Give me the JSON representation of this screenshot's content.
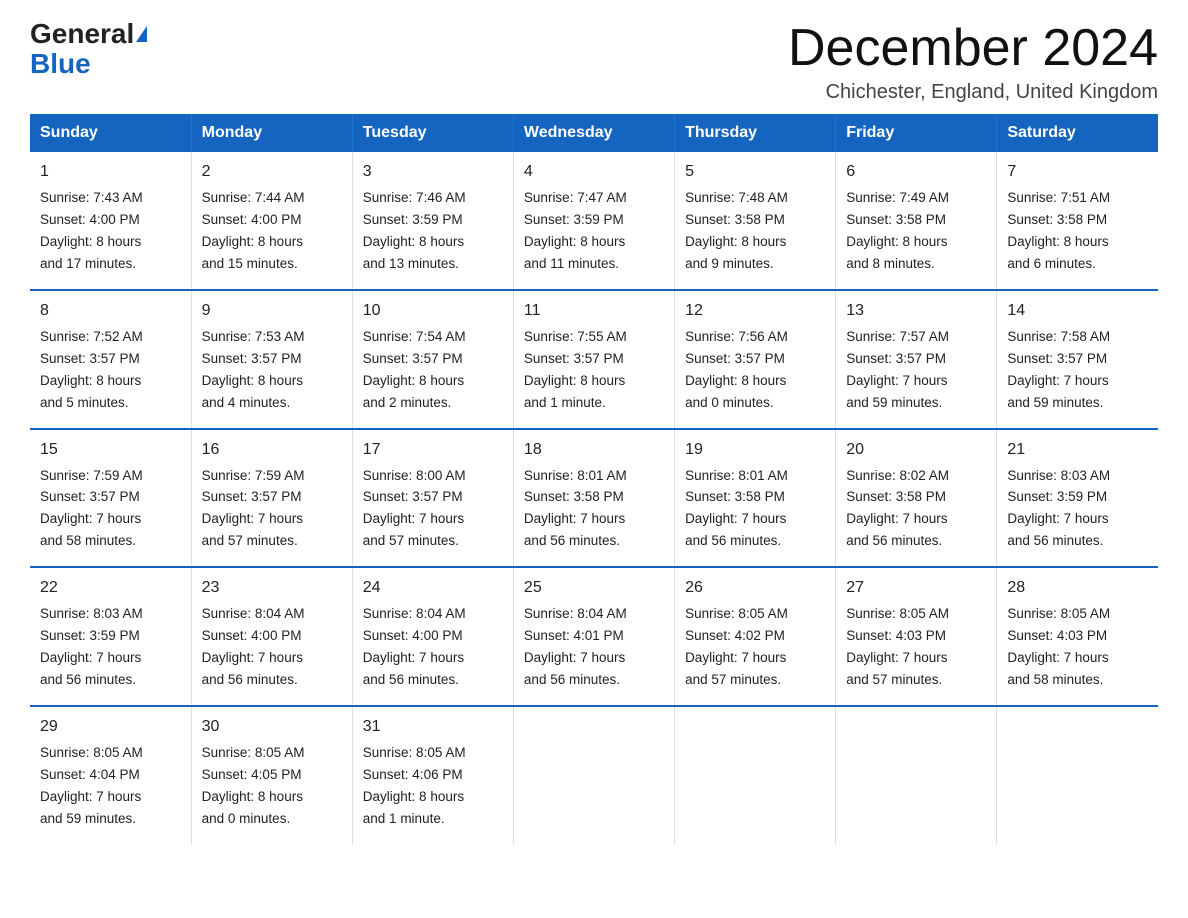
{
  "logo": {
    "general": "General",
    "blue": "Blue",
    "triangle_color": "#1565c0"
  },
  "title": "December 2024",
  "subtitle": "Chichester, England, United Kingdom",
  "weekdays": [
    "Sunday",
    "Monday",
    "Tuesday",
    "Wednesday",
    "Thursday",
    "Friday",
    "Saturday"
  ],
  "weeks": [
    [
      {
        "day": "1",
        "sunrise": "7:43 AM",
        "sunset": "4:00 PM",
        "daylight": "8 hours and 17 minutes."
      },
      {
        "day": "2",
        "sunrise": "7:44 AM",
        "sunset": "4:00 PM",
        "daylight": "8 hours and 15 minutes."
      },
      {
        "day": "3",
        "sunrise": "7:46 AM",
        "sunset": "3:59 PM",
        "daylight": "8 hours and 13 minutes."
      },
      {
        "day": "4",
        "sunrise": "7:47 AM",
        "sunset": "3:59 PM",
        "daylight": "8 hours and 11 minutes."
      },
      {
        "day": "5",
        "sunrise": "7:48 AM",
        "sunset": "3:58 PM",
        "daylight": "8 hours and 9 minutes."
      },
      {
        "day": "6",
        "sunrise": "7:49 AM",
        "sunset": "3:58 PM",
        "daylight": "8 hours and 8 minutes."
      },
      {
        "day": "7",
        "sunrise": "7:51 AM",
        "sunset": "3:58 PM",
        "daylight": "8 hours and 6 minutes."
      }
    ],
    [
      {
        "day": "8",
        "sunrise": "7:52 AM",
        "sunset": "3:57 PM",
        "daylight": "8 hours and 5 minutes."
      },
      {
        "day": "9",
        "sunrise": "7:53 AM",
        "sunset": "3:57 PM",
        "daylight": "8 hours and 4 minutes."
      },
      {
        "day": "10",
        "sunrise": "7:54 AM",
        "sunset": "3:57 PM",
        "daylight": "8 hours and 2 minutes."
      },
      {
        "day": "11",
        "sunrise": "7:55 AM",
        "sunset": "3:57 PM",
        "daylight": "8 hours and 1 minute."
      },
      {
        "day": "12",
        "sunrise": "7:56 AM",
        "sunset": "3:57 PM",
        "daylight": "8 hours and 0 minutes."
      },
      {
        "day": "13",
        "sunrise": "7:57 AM",
        "sunset": "3:57 PM",
        "daylight": "7 hours and 59 minutes."
      },
      {
        "day": "14",
        "sunrise": "7:58 AM",
        "sunset": "3:57 PM",
        "daylight": "7 hours and 59 minutes."
      }
    ],
    [
      {
        "day": "15",
        "sunrise": "7:59 AM",
        "sunset": "3:57 PM",
        "daylight": "7 hours and 58 minutes."
      },
      {
        "day": "16",
        "sunrise": "7:59 AM",
        "sunset": "3:57 PM",
        "daylight": "7 hours and 57 minutes."
      },
      {
        "day": "17",
        "sunrise": "8:00 AM",
        "sunset": "3:57 PM",
        "daylight": "7 hours and 57 minutes."
      },
      {
        "day": "18",
        "sunrise": "8:01 AM",
        "sunset": "3:58 PM",
        "daylight": "7 hours and 56 minutes."
      },
      {
        "day": "19",
        "sunrise": "8:01 AM",
        "sunset": "3:58 PM",
        "daylight": "7 hours and 56 minutes."
      },
      {
        "day": "20",
        "sunrise": "8:02 AM",
        "sunset": "3:58 PM",
        "daylight": "7 hours and 56 minutes."
      },
      {
        "day": "21",
        "sunrise": "8:03 AM",
        "sunset": "3:59 PM",
        "daylight": "7 hours and 56 minutes."
      }
    ],
    [
      {
        "day": "22",
        "sunrise": "8:03 AM",
        "sunset": "3:59 PM",
        "daylight": "7 hours and 56 minutes."
      },
      {
        "day": "23",
        "sunrise": "8:04 AM",
        "sunset": "4:00 PM",
        "daylight": "7 hours and 56 minutes."
      },
      {
        "day": "24",
        "sunrise": "8:04 AM",
        "sunset": "4:00 PM",
        "daylight": "7 hours and 56 minutes."
      },
      {
        "day": "25",
        "sunrise": "8:04 AM",
        "sunset": "4:01 PM",
        "daylight": "7 hours and 56 minutes."
      },
      {
        "day": "26",
        "sunrise": "8:05 AM",
        "sunset": "4:02 PM",
        "daylight": "7 hours and 57 minutes."
      },
      {
        "day": "27",
        "sunrise": "8:05 AM",
        "sunset": "4:03 PM",
        "daylight": "7 hours and 57 minutes."
      },
      {
        "day": "28",
        "sunrise": "8:05 AM",
        "sunset": "4:03 PM",
        "daylight": "7 hours and 58 minutes."
      }
    ],
    [
      {
        "day": "29",
        "sunrise": "8:05 AM",
        "sunset": "4:04 PM",
        "daylight": "7 hours and 59 minutes."
      },
      {
        "day": "30",
        "sunrise": "8:05 AM",
        "sunset": "4:05 PM",
        "daylight": "8 hours and 0 minutes."
      },
      {
        "day": "31",
        "sunrise": "8:05 AM",
        "sunset": "4:06 PM",
        "daylight": "8 hours and 1 minute."
      },
      null,
      null,
      null,
      null
    ]
  ],
  "labels": {
    "sunrise": "Sunrise:",
    "sunset": "Sunset:",
    "daylight": "Daylight:"
  }
}
